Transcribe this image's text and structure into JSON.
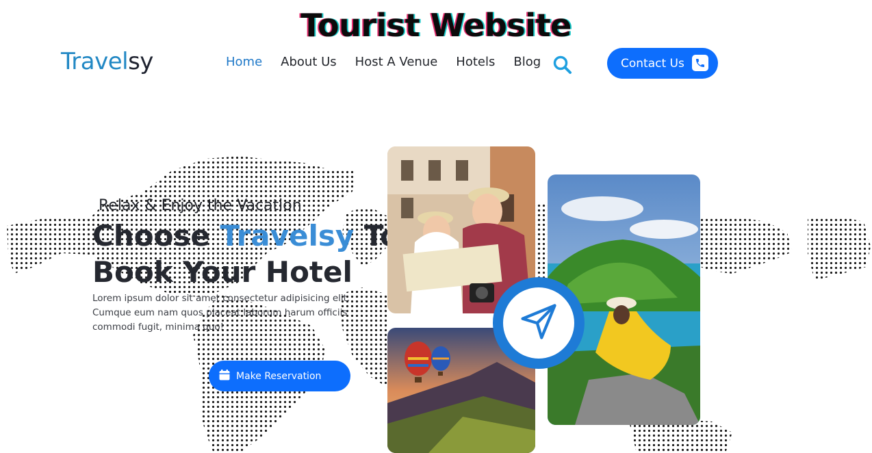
{
  "banner": {
    "title": "Tourist Website"
  },
  "brand": {
    "logo_part1": "Travel",
    "logo_part2": "sy"
  },
  "nav": {
    "items": [
      {
        "label": "Home",
        "active": true
      },
      {
        "label": "About Us"
      },
      {
        "label": "Host A Venue"
      },
      {
        "label": "Hotels"
      },
      {
        "label": "Blog"
      }
    ],
    "contact_label": "Contact Us"
  },
  "hero": {
    "subtitle": "Relax & Enjoy the Vacation",
    "title_part1": "Choose",
    "title_accent": "Travelsy",
    "title_part2": "To",
    "title_line2": "Book Your Hotel",
    "description": "Lorem ipsum dolor sit amet consectetur adipisicing elit. Cumque eum nam quos placeat laborum harum officiis commodi fugit, minima quo!",
    "button_label": "Make Reservation"
  },
  "icons": {
    "search": "search-icon",
    "phone": "phone-icon",
    "calendar": "calendar-icon",
    "send": "paper-plane-icon"
  },
  "colors": {
    "primary": "#0d6efd",
    "accent": "#3a8dd6",
    "nav_active": "#1e78c8",
    "logo": "#2288c4"
  }
}
